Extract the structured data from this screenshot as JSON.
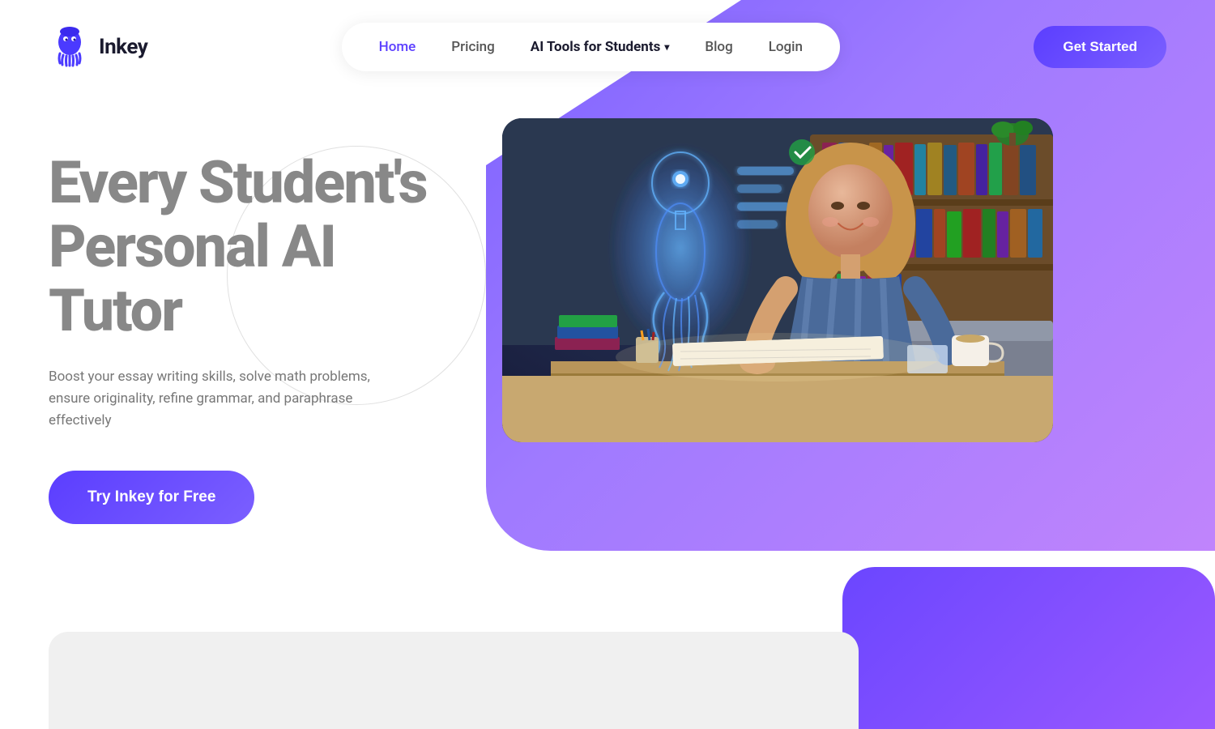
{
  "brand": {
    "name": "Inkey",
    "logo_icon": "squid-icon"
  },
  "nav": {
    "items": [
      {
        "id": "home",
        "label": "Home",
        "active": true
      },
      {
        "id": "pricing",
        "label": "Pricing",
        "active": false
      },
      {
        "id": "ai-tools",
        "label": "AI Tools for Students",
        "active": false,
        "has_dropdown": true
      },
      {
        "id": "blog",
        "label": "Blog",
        "active": false
      },
      {
        "id": "login",
        "label": "Login",
        "active": false
      }
    ],
    "cta_label": "Get Started"
  },
  "hero": {
    "title": "Every Student's Personal AI Tutor",
    "subtitle": "Boost your essay writing skills, solve math problems, ensure originality, refine grammar, and paraphrase effectively",
    "cta_label": "Try Inkey for Free"
  },
  "colors": {
    "primary": "#5B3EFF",
    "primary_gradient_end": "#7B5FFF",
    "nav_active": "#5B3EFF",
    "title_color": "#888888",
    "subtitle_color": "#777777",
    "bg_blob": "#8B6AFF",
    "bg_blob_bottom": "#6B46FF"
  }
}
